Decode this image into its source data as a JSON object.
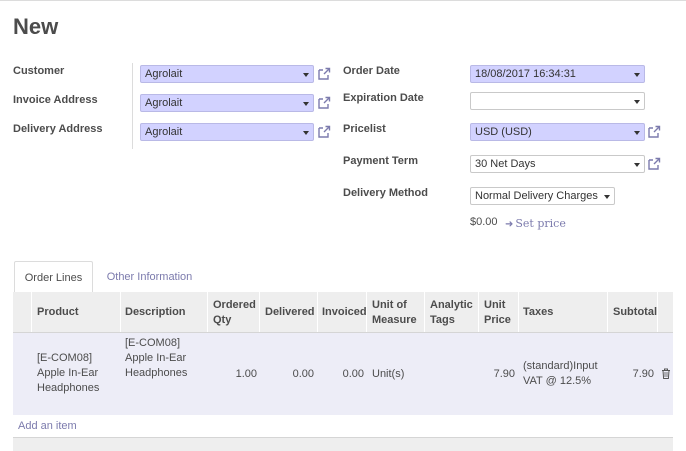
{
  "page": {
    "title": "New"
  },
  "left_fields": [
    {
      "label": "Customer",
      "value": "Agrolait"
    },
    {
      "label": "Invoice Address",
      "value": "Agrolait"
    },
    {
      "label": "Delivery Address",
      "value": "Agrolait"
    }
  ],
  "right_fields": {
    "order_date": {
      "label": "Order Date",
      "value": "18/08/2017 16:34:31"
    },
    "expiration_date": {
      "label": "Expiration Date",
      "value": ""
    },
    "pricelist": {
      "label": "Pricelist",
      "value": "USD (USD)"
    },
    "payment_term": {
      "label": "Payment Term",
      "value": "30 Net Days"
    },
    "delivery_method": {
      "label": "Delivery Method",
      "value": "Normal Delivery Charges"
    },
    "delivery_amount": "$0.00",
    "set_price_label": "Set price"
  },
  "tabs": [
    {
      "label": "Order Lines",
      "active": true
    },
    {
      "label": "Other Information",
      "active": false
    }
  ],
  "table": {
    "headers": {
      "product": "Product",
      "description": "Description",
      "ordered_qty_1": "Ordered",
      "ordered_qty_2": "Qty",
      "delivered": "Delivered",
      "invoiced": "Invoiced",
      "uom_1": "Unit of",
      "uom_2": "Measure",
      "analytic_1": "Analytic",
      "analytic_2": "Tags",
      "unit_price_1": "Unit",
      "unit_price_2": "Price",
      "taxes": "Taxes",
      "subtotal": "Subtotal"
    },
    "rows": [
      {
        "product": [
          "[E-COM08]",
          "Apple In-Ear",
          "Headphones"
        ],
        "description": [
          "[E-COM08]",
          "Apple In-Ear",
          "Headphones"
        ],
        "ordered_qty": "1.00",
        "delivered": "0.00",
        "invoiced": "0.00",
        "uom": "Unit(s)",
        "analytic_tags": "",
        "unit_price": "7.90",
        "taxes": [
          "(standard)Input",
          "VAT @ 12.5%"
        ],
        "subtotal": "7.90"
      }
    ],
    "add_item_label": "Add an item"
  },
  "icons": {
    "dropdown": "chevron-down-icon",
    "external": "external-link-icon",
    "arrow": "arrow-right-icon",
    "delete": "trash-icon"
  },
  "colors": {
    "required_field_bg": "#d2d2ff",
    "link": "#7c7bad",
    "row_bg": "#ededf7",
    "header_bg": "#eeeeee"
  }
}
